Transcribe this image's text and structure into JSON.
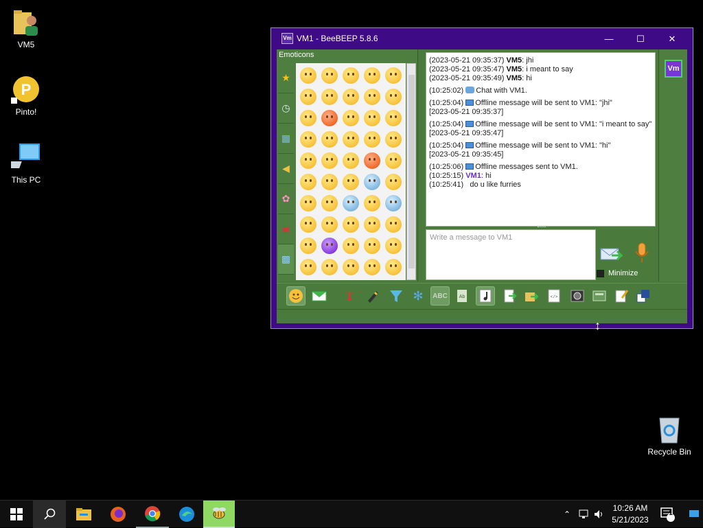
{
  "desktop": {
    "icons": [
      {
        "label": "VM5",
        "icon": "user-folder-icon"
      },
      {
        "label": "Pinto!",
        "icon": "pinto-app-icon"
      },
      {
        "label": "This PC",
        "icon": "computer-icon"
      },
      {
        "label": "Recycle Bin",
        "icon": "recycle-bin-icon"
      }
    ]
  },
  "window": {
    "title": "VM1 - BeeBEEP 5.8.6",
    "app_icon_text": "Vm",
    "minimize_glyph": "—",
    "maximize_glyph": "☐",
    "close_glyph": "✕",
    "accent_color": "#3f0a86",
    "panel_color": "#4a7a3c"
  },
  "emoticons": {
    "header": "Emoticons",
    "categories": [
      "favorites-star-icon",
      "recent-clock-icon",
      "objects-icon",
      "horn-icon",
      "flower-icon",
      "car-icon",
      "symbols-icon"
    ]
  },
  "chat": {
    "lines": [
      {
        "time": "(2023-05-21 09:35:37)",
        "sender": "VM5",
        "text": "jhi"
      },
      {
        "time": "(2023-05-21 09:35:47)",
        "sender": "VM5",
        "text": "i meant to say"
      },
      {
        "time": "(2023-05-21 09:35:49)",
        "sender": "VM5",
        "text": "hi"
      }
    ],
    "system_chat": {
      "time": "(10:25:02)",
      "text": "Chat with VM1."
    },
    "offline": [
      {
        "time": "(10:25:04)",
        "text": "Offline message will be sent to VM1: \"jhi\"",
        "stamp": "[2023-05-21 09:35:37]"
      },
      {
        "time": "(10:25:04)",
        "text": "Offline message will be sent to VM1: \"i meant to say\"",
        "stamp": "[2023-05-21 09:35:47]"
      },
      {
        "time": "(10:25:04)",
        "text": "Offline message will be sent to VM1: \"hi\"",
        "stamp": "[2023-05-21 09:35:45]"
      }
    ],
    "offline_sent": {
      "time": "(10:25:06)",
      "text": "Offline messages sent to VM1."
    },
    "reply": {
      "time": "(10:25:15)",
      "sender": "VM1",
      "text": "hi"
    },
    "last": {
      "time": "(10:25:41)",
      "text": "do   u like furries"
    }
  },
  "compose": {
    "placeholder": "Write a message to VM1",
    "minimize_label": "Minimize",
    "avatar_text": "Vm"
  },
  "toolbar": {
    "buttons": [
      "emoticons-icon",
      "send-mail-icon",
      "font-icon",
      "pen-color-icon",
      "filter-icon",
      "settings-gear-icon",
      "spellcheck-icon",
      "word-completion-icon",
      "music-note-icon",
      "file-transfer-icon",
      "folder-transfer-icon",
      "html-icon",
      "screenshot-icon",
      "save-chat-icon",
      "clear-chat-icon",
      "detach-icon"
    ]
  },
  "taskbar": {
    "time": "10:26 AM",
    "date": "5/21/2023",
    "notification_count": "1"
  }
}
